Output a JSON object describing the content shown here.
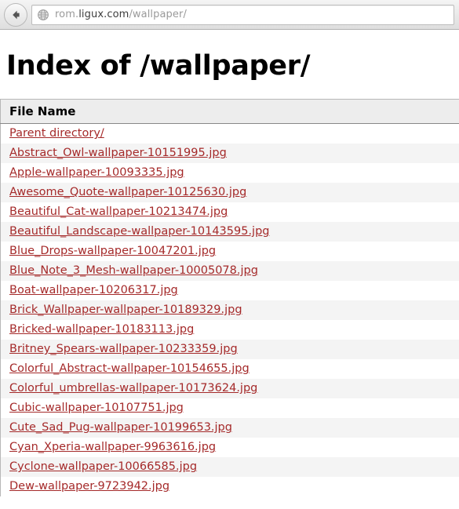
{
  "browser": {
    "back_button_label": "Back",
    "back_icon": "arrow-left-icon",
    "site_icon": "globe-icon",
    "url_prefix": "rom.",
    "url_domain": "ligux.com",
    "url_path": "/wallpaper/",
    "url_full": "rom.ligux.com/wallpaper/"
  },
  "page": {
    "title": "Index of /wallpaper/",
    "table": {
      "columns": [
        "File Name"
      ],
      "rows": [
        {
          "name": "Parent directory/"
        },
        {
          "name": "Abstract_Owl-wallpaper-10151995.jpg"
        },
        {
          "name": "Apple-wallpaper-10093335.jpg"
        },
        {
          "name": "Awesome_Quote-wallpaper-10125630.jpg"
        },
        {
          "name": "Beautiful_Cat-wallpaper-10213474.jpg"
        },
        {
          "name": "Beautiful_Landscape-wallpaper-10143595.jpg"
        },
        {
          "name": "Blue_Drops-wallpaper-10047201.jpg"
        },
        {
          "name": "Blue_Note_3_Mesh-wallpaper-10005078.jpg"
        },
        {
          "name": "Boat-wallpaper-10206317.jpg"
        },
        {
          "name": "Brick_Wallpaper-wallpaper-10189329.jpg"
        },
        {
          "name": "Bricked-wallpaper-10183113.jpg"
        },
        {
          "name": "Britney_Spears-wallpaper-10233359.jpg"
        },
        {
          "name": "Colorful_Abstract-wallpaper-10154655.jpg"
        },
        {
          "name": "Colorful_umbrellas-wallpaper-10173624.jpg"
        },
        {
          "name": "Cubic-wallpaper-10107751.jpg"
        },
        {
          "name": "Cute_Sad_Pug-wallpaper-10199653.jpg"
        },
        {
          "name": "Cyan_Xperia-wallpaper-9963616.jpg"
        },
        {
          "name": "Cyclone-wallpaper-10066585.jpg"
        },
        {
          "name": "Dew-wallpaper-9723942.jpg"
        }
      ]
    }
  },
  "colors": {
    "link": "#a52a2a",
    "header_bg": "#ededed",
    "stripe_bg": "#f4f4f4",
    "border": "#b7b7b7",
    "url_domain_text": "#3d3d3d",
    "url_path_text": "#9a9a9a"
  }
}
